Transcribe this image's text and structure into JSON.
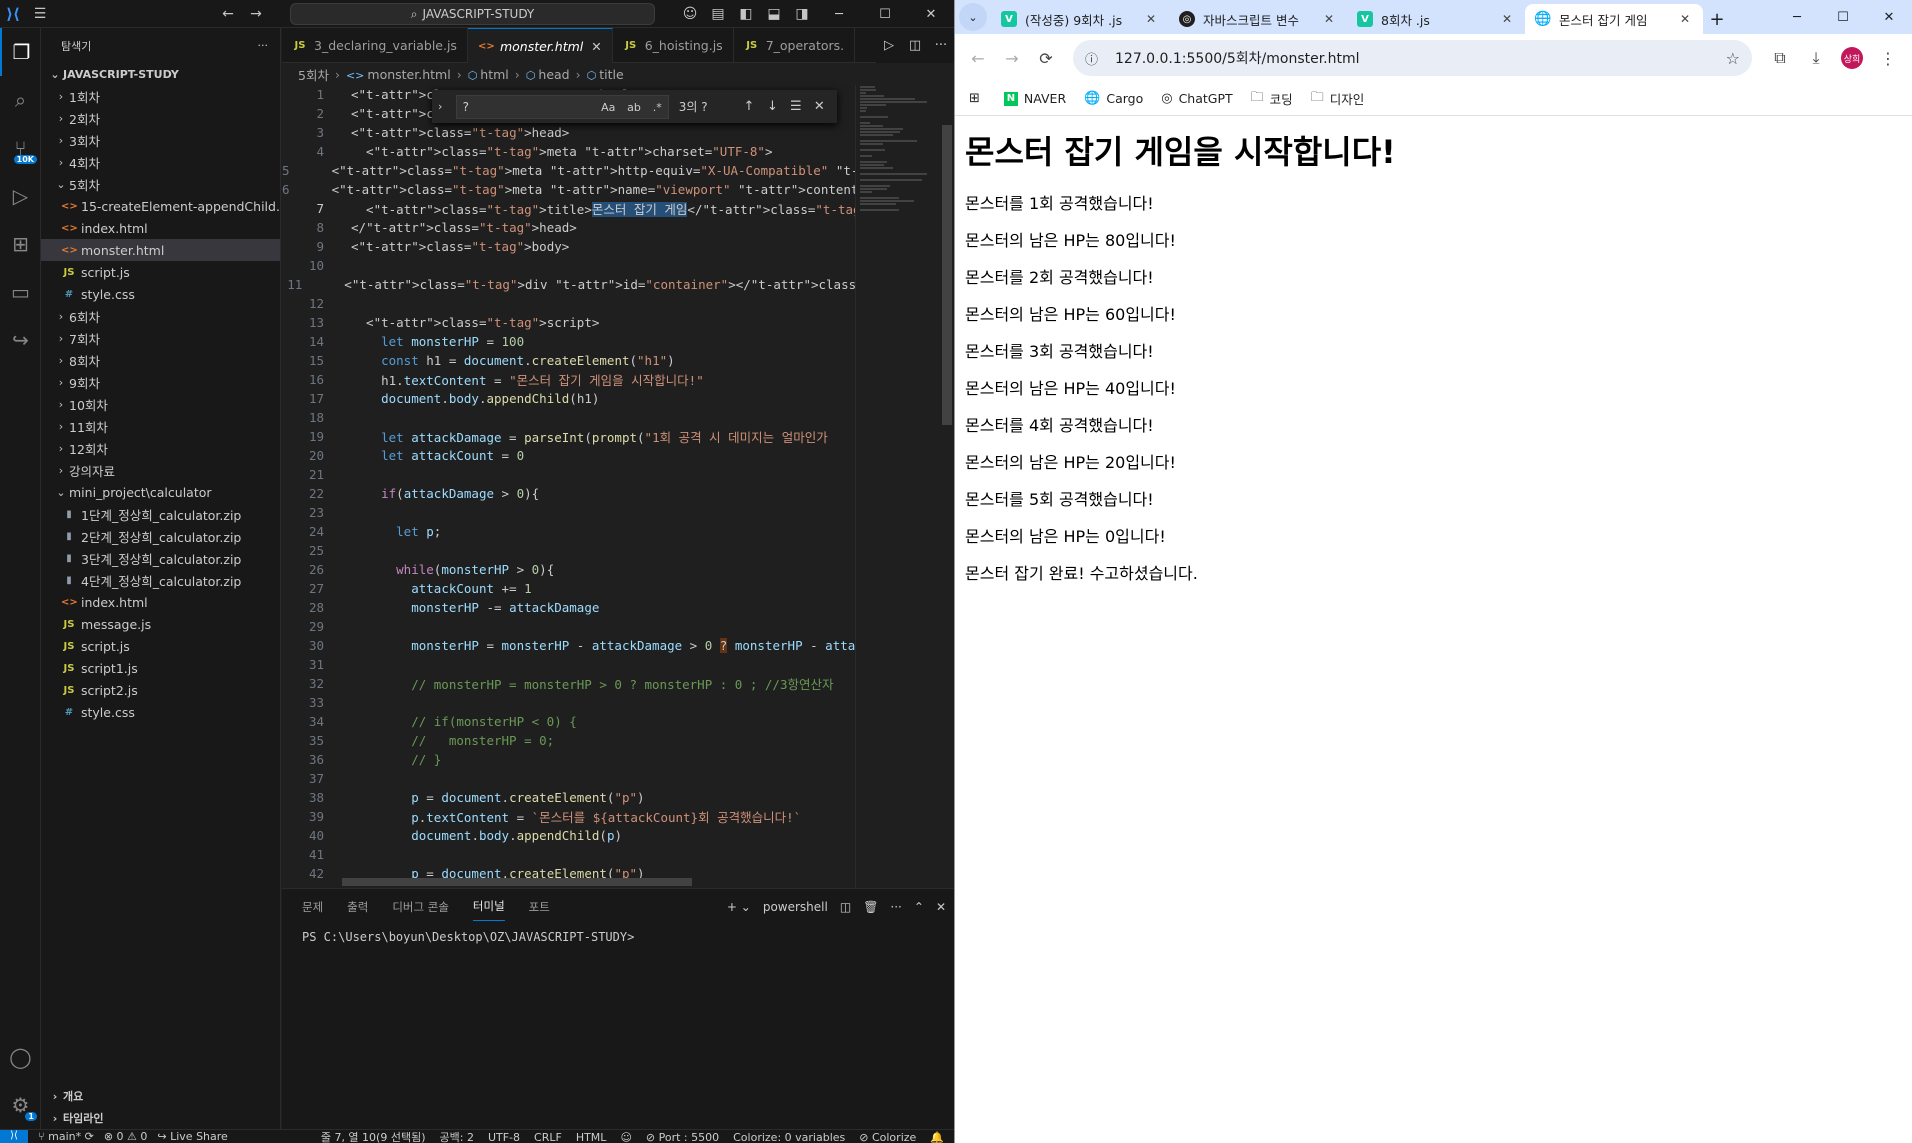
{
  "vscode": {
    "command_center": "JAVASCRIPT-STUDY",
    "explorer_title": "탐색기",
    "workspace": "JAVASCRIPT-STUDY",
    "tree": [
      {
        "type": "folder",
        "label": "1회차",
        "open": false,
        "depth": 0
      },
      {
        "type": "folder",
        "label": "2회차",
        "open": false,
        "depth": 0
      },
      {
        "type": "folder",
        "label": "3회차",
        "open": false,
        "depth": 0
      },
      {
        "type": "folder",
        "label": "4회차",
        "open": false,
        "depth": 0
      },
      {
        "type": "folder",
        "label": "5회차",
        "open": true,
        "depth": 0
      },
      {
        "type": "html",
        "label": "15-createElement-appendChild.h...",
        "depth": 1
      },
      {
        "type": "html",
        "label": "index.html",
        "depth": 1
      },
      {
        "type": "html",
        "label": "monster.html",
        "depth": 1,
        "selected": true
      },
      {
        "type": "js",
        "label": "script.js",
        "depth": 1
      },
      {
        "type": "css",
        "label": "style.css",
        "depth": 1
      },
      {
        "type": "folder",
        "label": "6회차",
        "open": false,
        "depth": 0
      },
      {
        "type": "folder",
        "label": "7회차",
        "open": false,
        "depth": 0
      },
      {
        "type": "folder",
        "label": "8회차",
        "open": false,
        "depth": 0
      },
      {
        "type": "folder",
        "label": "9회차",
        "open": false,
        "depth": 0
      },
      {
        "type": "folder",
        "label": "10회차",
        "open": false,
        "depth": 0
      },
      {
        "type": "folder",
        "label": "11회차",
        "open": false,
        "depth": 0
      },
      {
        "type": "folder",
        "label": "12회차",
        "open": false,
        "depth": 0
      },
      {
        "type": "folder",
        "label": "강의자료",
        "open": false,
        "depth": 0
      },
      {
        "type": "folder",
        "label": "mini_project\\calculator",
        "open": true,
        "depth": 0
      },
      {
        "type": "zip",
        "label": "1단계_정상희_calculator.zip",
        "depth": 1
      },
      {
        "type": "zip",
        "label": "2단계_정상희_calculator.zip",
        "depth": 1
      },
      {
        "type": "zip",
        "label": "3단계_정상희_calculator.zip",
        "depth": 1
      },
      {
        "type": "zip",
        "label": "4단계_정상희_calculator.zip",
        "depth": 1
      },
      {
        "type": "html",
        "label": "index.html",
        "depth": 1
      },
      {
        "type": "js",
        "label": "message.js",
        "depth": 1
      },
      {
        "type": "js",
        "label": "script.js",
        "depth": 1
      },
      {
        "type": "js",
        "label": "script1.js",
        "depth": 1
      },
      {
        "type": "js",
        "label": "script2.js",
        "depth": 1
      },
      {
        "type": "css",
        "label": "style.css",
        "depth": 1
      }
    ],
    "outline_label": "개요",
    "timeline_label": "타임라인",
    "tabs": [
      {
        "label": "3_declaring_variable.js",
        "icon": "JS",
        "active": false
      },
      {
        "label": "monster.html",
        "icon": "<>",
        "active": true
      },
      {
        "label": "6_hoisting.js",
        "icon": "JS",
        "active": false
      },
      {
        "label": "7_operators.",
        "icon": "JS",
        "active": false
      }
    ],
    "breadcrumb": [
      "5회차",
      "monster.html",
      "html",
      "head",
      "title"
    ],
    "find": {
      "query": "?",
      "count": "3의 ?",
      "case": "Aa",
      "word": "ab",
      "regex": ".*"
    },
    "code_lines": [
      "<!DOCTYPE html>",
      "<html lang=\"en\">",
      "<head>",
      "  <meta charset=\"UTF-8\">",
      "  <meta http-equiv=\"X-UA-Compatible\" content=\"IE=edge\">",
      "  <meta name=\"viewport\" content=\"width=device-width, initial-scale=",
      "  <title>몬스터 잡기 게임</title>",
      "</head>",
      "<body>",
      "",
      "  <div id=\"container\"></div>",
      "",
      "  <script>",
      "    let monsterHP = 100",
      "    const h1 = document.createElement(\"h1\")",
      "    h1.textContent = \"몬스터 잡기 게임을 시작합니다!\"",
      "    document.body.appendChild(h1)",
      "",
      "    let attackDamage = parseInt(prompt(\"1회 공격 시 데미지는 얼마인가",
      "    let attackCount = 0",
      "",
      "    if(attackDamage > 0){",
      "",
      "      let p;",
      "",
      "      while(monsterHP > 0){",
      "        attackCount += 1",
      "        monsterHP -= attackDamage",
      "",
      "        monsterHP = monsterHP - attackDamage > 0 ? monsterHP - atta",
      "",
      "        // monsterHP = monsterHP > 0 ? monsterHP : 0 ; //3항연산자",
      "",
      "        // if(monsterHP < 0) {",
      "        //   monsterHP = 0;",
      "        // }",
      "",
      "        p = document.createElement(\"p\")",
      "        p.textContent = `몬스터를 ${attackCount}회 공격했습니다!`",
      "        document.body.appendChild(p)",
      "",
      "        p = document.createElement(\"p\")"
    ],
    "panel_tabs": [
      "문제",
      "출력",
      "디버그 콘솔",
      "터미널",
      "포트"
    ],
    "panel_active": "터미널",
    "terminal_shell": "powershell",
    "terminal_prompt": "PS C:\\Users\\boyun\\Desktop\\OZ\\JAVASCRIPT-STUDY>",
    "status": {
      "branch": "main*",
      "problems": "⊗ 0 ⚠ 0",
      "liveshare": "Live Share",
      "cursor": "줄 7, 열 10(9 선택됨)",
      "spaces": "공백: 2",
      "encoding": "UTF-8",
      "eol": "CRLF",
      "language": "HTML",
      "port": "Port : 5500",
      "colorize": "Colorize: 0 variables",
      "colorize2": "Colorize"
    },
    "scm_badge": "10K",
    "settings_badge": "1"
  },
  "chrome": {
    "tabs": [
      {
        "label": "(작성중) 9회차 .js",
        "fav": "V",
        "favtype": "vel",
        "active": false
      },
      {
        "label": "자바스크립트 변수",
        "fav": "◎",
        "favtype": "gpt",
        "active": false
      },
      {
        "label": "8회차 .js",
        "fav": "V",
        "favtype": "vel",
        "active": false
      },
      {
        "label": "몬스터 잡기 게임",
        "fav": "🌐",
        "favtype": "globe",
        "active": true
      }
    ],
    "url": "127.0.0.1:5500/5회차/monster.html",
    "bookmarks": [
      {
        "label": "NAVER",
        "icon": "N",
        "type": "naver"
      },
      {
        "label": "Cargo",
        "icon": "🌐",
        "type": "globe"
      },
      {
        "label": "ChatGPT",
        "icon": "◎",
        "type": "gpt"
      },
      {
        "label": "코딩",
        "icon": "🗀",
        "type": "folder"
      },
      {
        "label": "디자인",
        "icon": "🗀",
        "type": "folder"
      }
    ],
    "avatar": "상희",
    "page": {
      "heading": "몬스터 잡기 게임을 시작합니다!",
      "lines": [
        "몬스터를 1회 공격했습니다!",
        "몬스터의 남은 HP는 80입니다!",
        "몬스터를 2회 공격했습니다!",
        "몬스터의 남은 HP는 60입니다!",
        "몬스터를 3회 공격했습니다!",
        "몬스터의 남은 HP는 40입니다!",
        "몬스터를 4회 공격했습니다!",
        "몬스터의 남은 HP는 20입니다!",
        "몬스터를 5회 공격했습니다!",
        "몬스터의 남은 HP는 0입니다!",
        "몬스터 잡기 완료! 수고하셨습니다."
      ]
    }
  }
}
